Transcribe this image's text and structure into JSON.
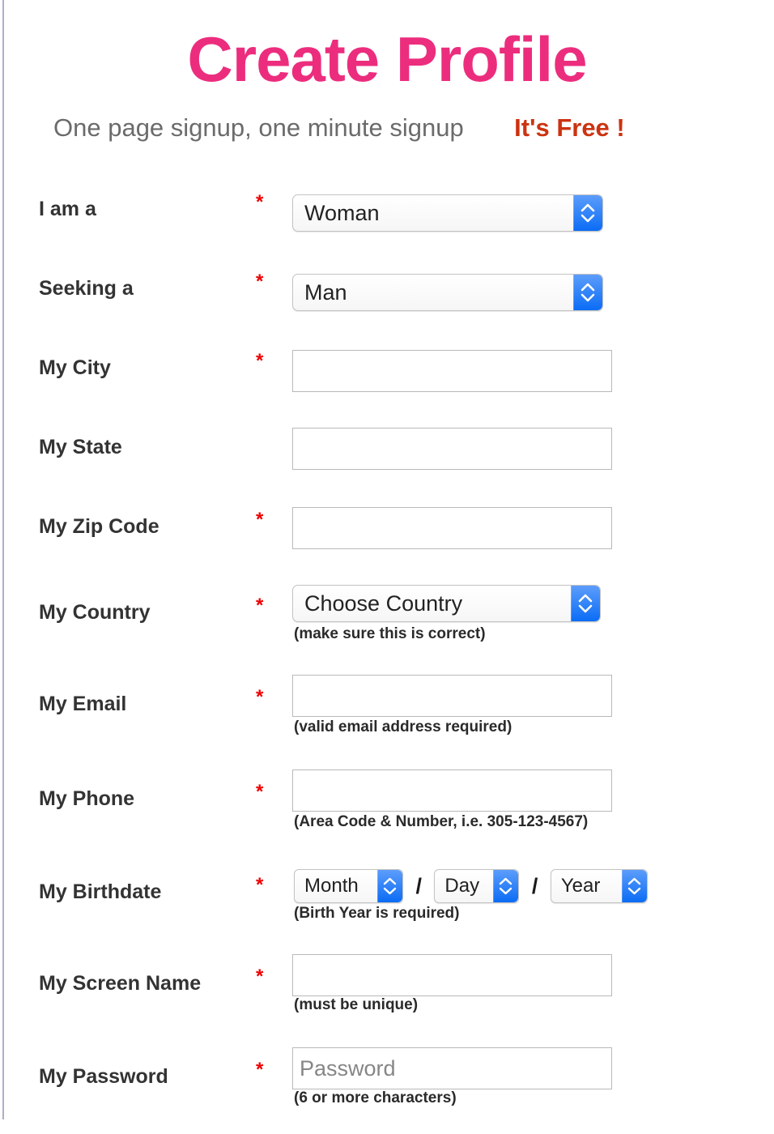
{
  "header": {
    "title": "Create Profile",
    "subtitle": "One page signup, one minute signup",
    "free_badge": "It's Free !",
    "title_color": "#ec2d7e",
    "subtitle_color": "#6b6b6b",
    "free_badge_color": "#cc3311",
    "required_marker": "*",
    "required_marker_color": "#ee0000"
  },
  "form": {
    "rows": [
      {
        "label": "I am a",
        "required": "*",
        "control": "select",
        "value": "Woman",
        "hint": ""
      },
      {
        "label": "Seeking a",
        "required": "*",
        "control": "select",
        "value": "Man",
        "hint": ""
      },
      {
        "label": "My City",
        "required": "*",
        "control": "text",
        "value": "",
        "placeholder": "",
        "hint": ""
      },
      {
        "label": "My State",
        "required": "",
        "control": "text",
        "value": "",
        "placeholder": "",
        "hint": ""
      },
      {
        "label": "My Zip Code",
        "required": "*",
        "control": "text",
        "value": "",
        "placeholder": "",
        "hint": ""
      },
      {
        "label": "My Country",
        "required": "*",
        "control": "select",
        "value": "Choose Country",
        "hint": "(make sure this is correct)"
      },
      {
        "label": "My Email",
        "required": "*",
        "control": "text",
        "value": "",
        "placeholder": "",
        "hint": "(valid email address required)"
      },
      {
        "label": "My Phone",
        "required": "*",
        "control": "text",
        "value": "",
        "placeholder": "",
        "hint": "(Area Code & Number, i.e. 305-123-4567)"
      },
      {
        "label": "My Birthdate",
        "required": "*",
        "control": "date-group",
        "month_value": "Month",
        "day_value": "Day",
        "year_value": "Year",
        "separator": "/",
        "hint": "(Birth Year is required)"
      },
      {
        "label": "My Screen Name",
        "required": "*",
        "control": "text",
        "value": "",
        "placeholder": "",
        "hint": "(must be unique)"
      },
      {
        "label": "My Password",
        "required": "*",
        "control": "text",
        "value": "",
        "placeholder": "Password",
        "hint": "(6 or more characters)"
      }
    ]
  },
  "icons": {
    "stepper": "stepper-updown-icon"
  }
}
